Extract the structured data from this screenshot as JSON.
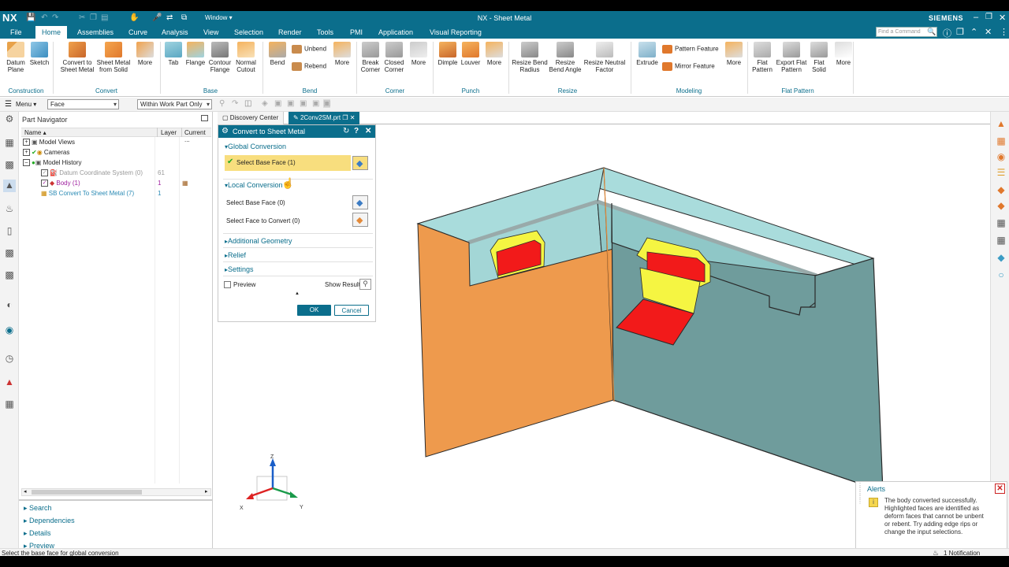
{
  "app": {
    "logo": "NX",
    "title": "NX - Sheet Metal",
    "window_menu": "Window",
    "brand": "SIEMENS"
  },
  "menu_tabs": [
    "File",
    "Home",
    "Assemblies",
    "Curve",
    "Analysis",
    "View",
    "Selection",
    "Render",
    "Tools",
    "PMI",
    "Application",
    "Visual Reporting"
  ],
  "active_tab": "Home",
  "find_command_placeholder": "Find a Command",
  "ribbon": {
    "construction": {
      "datum": "Datum Plane",
      "sketch": "Sketch",
      "group": "Construction"
    },
    "convert": {
      "convert_to": "Convert to Sheet Metal",
      "from_solid": "Sheet Metal from Solid",
      "more": "More",
      "group": "Convert"
    },
    "base": {
      "tab": "Tab",
      "flange": "Flange",
      "contour": "Contour Flange",
      "normal": "Normal Cutout",
      "group": "Base"
    },
    "bend": {
      "bend": "Bend",
      "unbend": "Unbend",
      "rebend": "Rebend",
      "more": "More",
      "group": "Bend"
    },
    "corner": {
      "break": "Break Corner",
      "closed": "Closed Corner",
      "more": "More",
      "group": "Corner"
    },
    "punch": {
      "dimple": "Dimple",
      "louver": "Louver",
      "more": "More",
      "group": "Punch"
    },
    "resize": {
      "radius": "Resize Bend Radius",
      "angle": "Resize Bend Angle",
      "neutral": "Resize Neutral Factor",
      "group": "Resize"
    },
    "modeling": {
      "extrude": "Extrude",
      "pattern": "Pattern Feature",
      "mirror": "Mirror Feature",
      "more": "More",
      "group": "Modeling"
    },
    "flat": {
      "flat_pattern": "Flat Pattern",
      "export": "Export Flat Pattern",
      "flat_solid": "Flat Solid",
      "more": "More",
      "group": "Flat Pattern"
    }
  },
  "filterbar": {
    "menu": "Menu",
    "filter": "Face",
    "scope": "Within Work Part Only"
  },
  "navigator": {
    "title": "Part Navigator",
    "col_name": "Name",
    "col_layer": "Layer",
    "col_current": "Current ...",
    "nodes": [
      {
        "label": "Model Views",
        "layer": ""
      },
      {
        "label": "Cameras",
        "layer": ""
      },
      {
        "label": "Model History",
        "layer": ""
      },
      {
        "label": "Datum Coordinate System (0)",
        "layer": "61"
      },
      {
        "label": "Body (1)",
        "layer": "1"
      },
      {
        "label": "SB Convert To Sheet Metal (7)",
        "layer": "1"
      }
    ],
    "sections": [
      "Search",
      "Dependencies",
      "Details",
      "Preview"
    ]
  },
  "doc_tabs": [
    "Discovery Center",
    "2Conv2SM.prt"
  ],
  "dialog": {
    "title": "Convert to Sheet Metal",
    "global_section": "Global Conversion",
    "select_base_face_global": "Select Base Face (1)",
    "local_section": "Local Conversion",
    "select_base_face_local": "Select Base Face (0)",
    "select_face_convert": "Select Face to Convert (0)",
    "additional": "Additional Geometry",
    "relief": "Relief",
    "settings": "Settings",
    "preview": "Preview",
    "show_result": "Show Result",
    "ok": "OK",
    "cancel": "Cancel"
  },
  "triad": {
    "z": "Z",
    "x": "X",
    "y": "Y"
  },
  "alerts": {
    "title": "Alerts",
    "message": "The body converted successfully. Highlighted faces are identified as deform faces that cannot be unbent or rebent. Try adding edge rips or change the input selections."
  },
  "status": {
    "prompt": "Select the base face for global conversion",
    "notification": "1 Notification"
  },
  "colors": {
    "brand": "#0b6e8c",
    "selection": "#f8de7e",
    "model_orange": "#ee9a4d",
    "model_teal": "#9fd3d3",
    "deform_red": "#f21a1a",
    "deform_yellow": "#f5f542"
  }
}
